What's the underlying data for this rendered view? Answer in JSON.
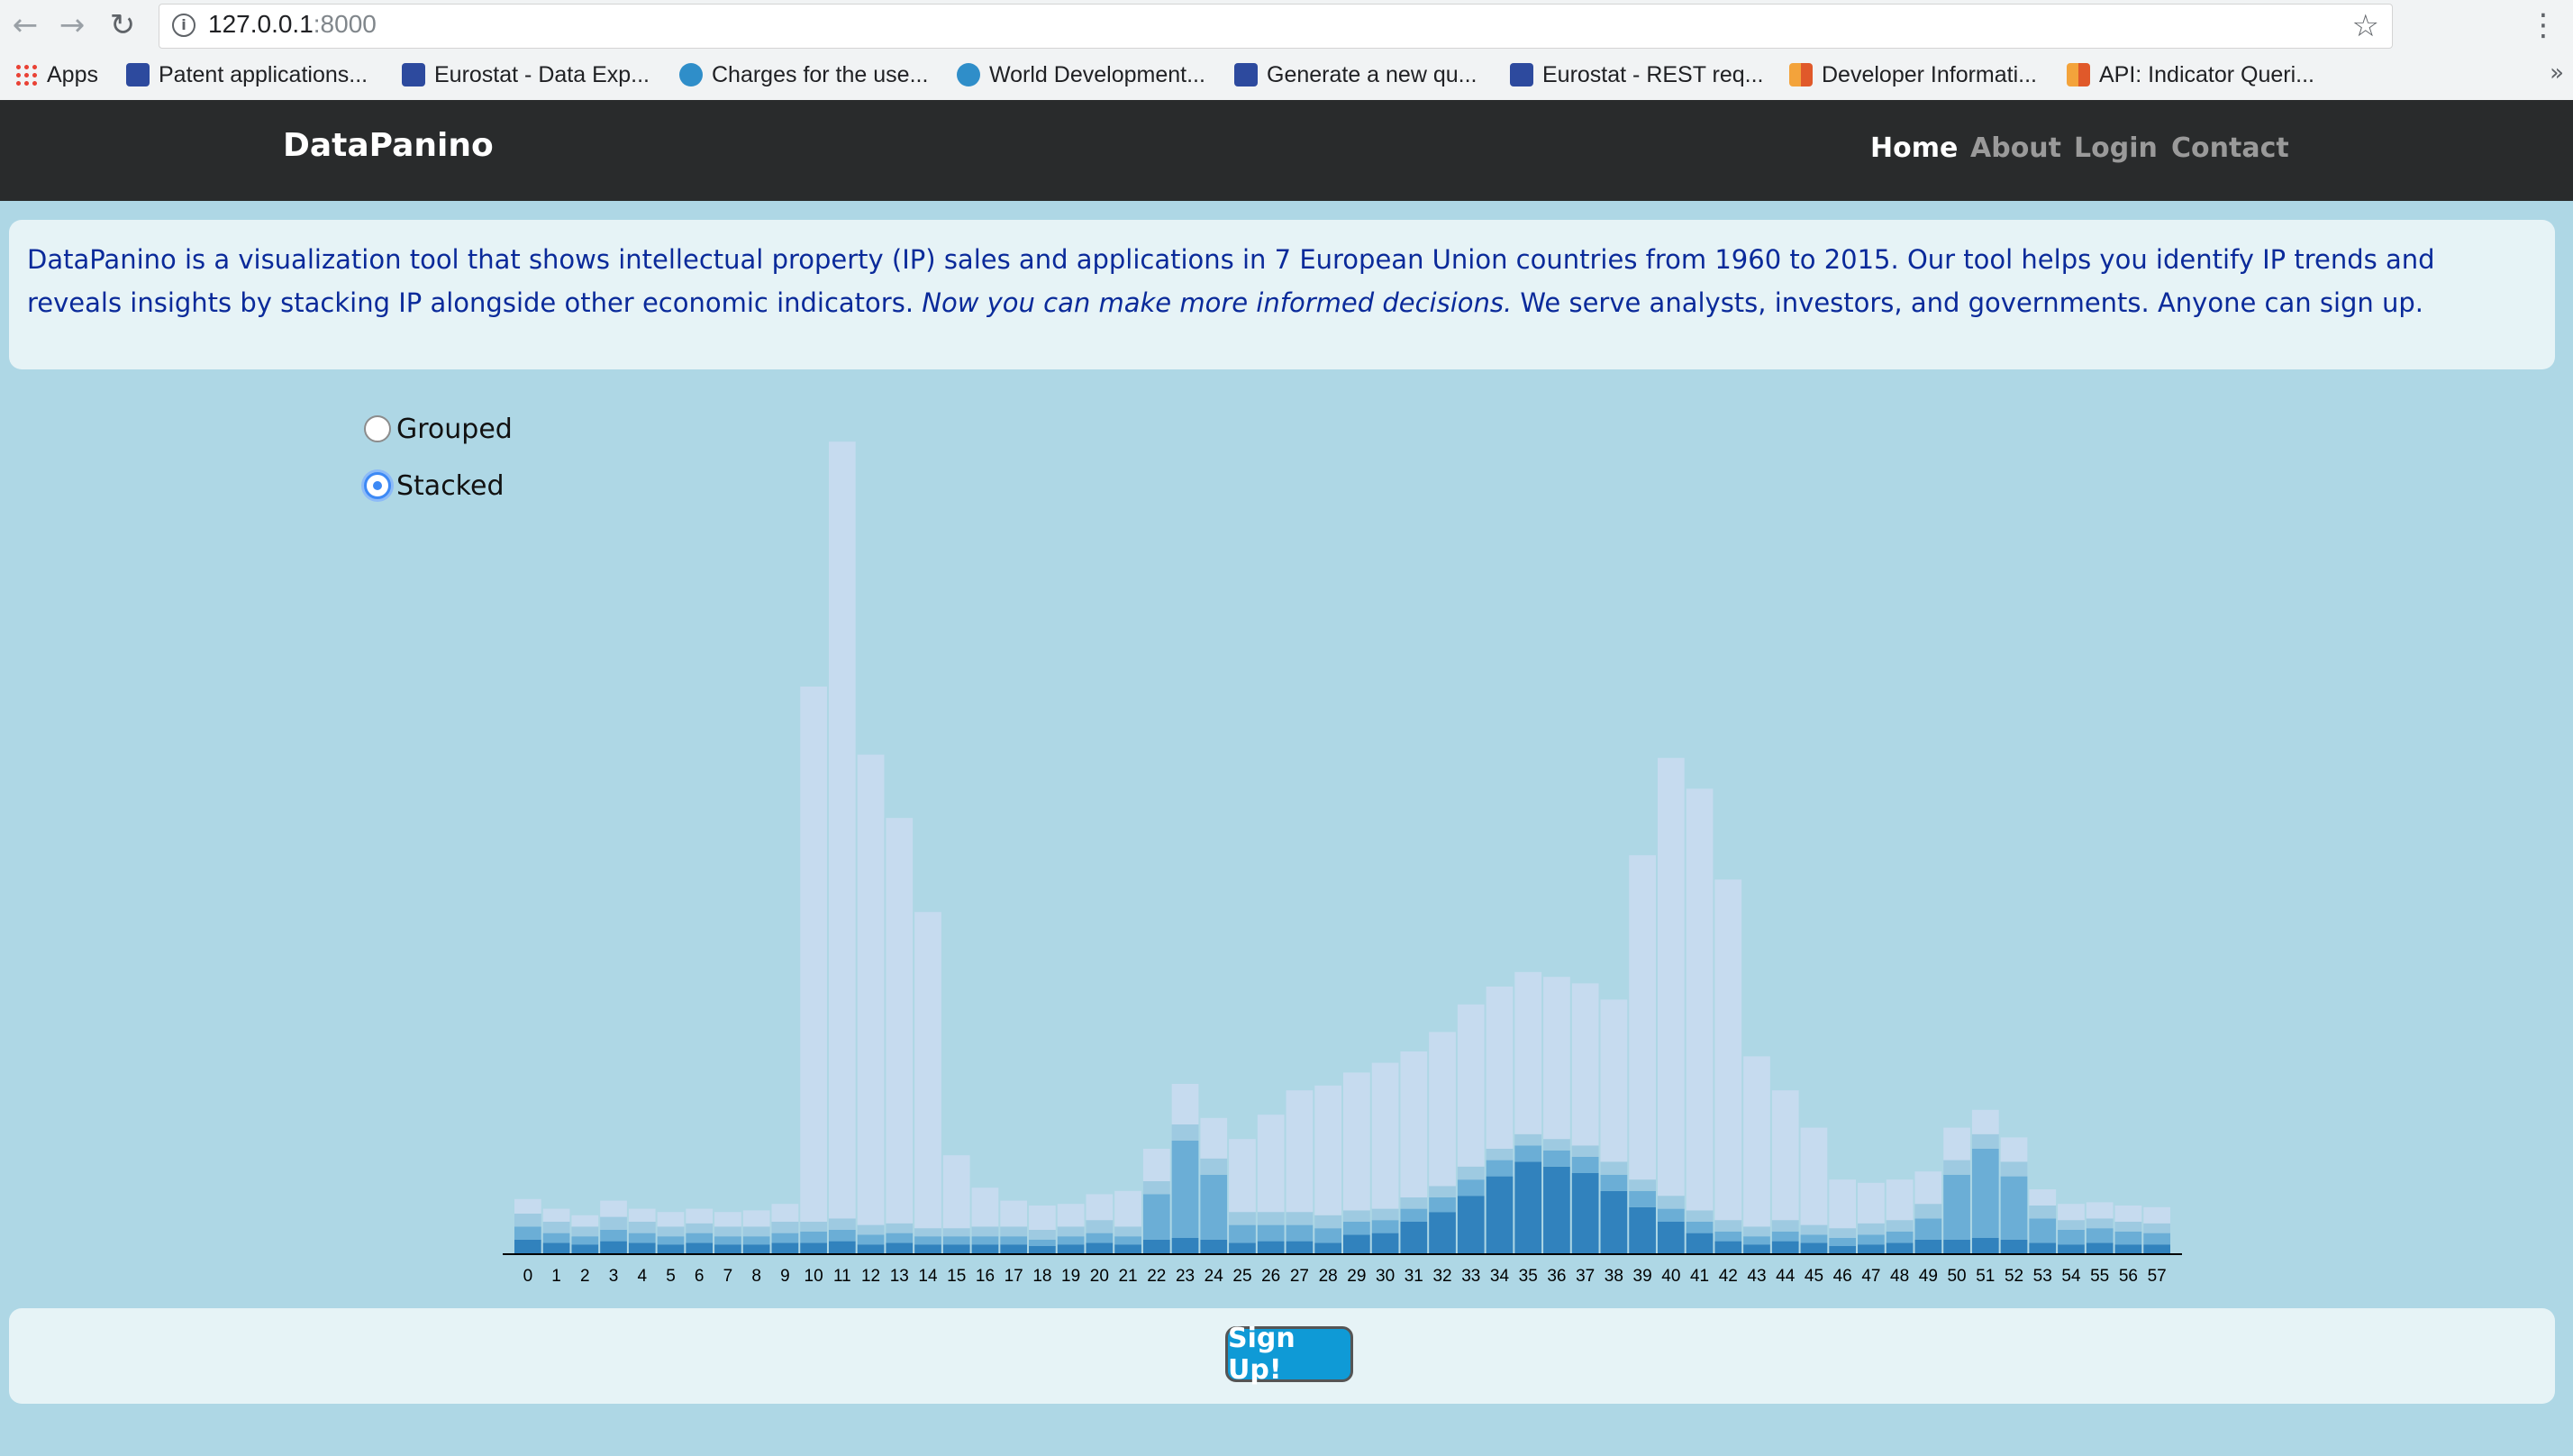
{
  "browser": {
    "url_host": "127.0.0.1",
    "url_port": ":8000",
    "bookmarks": [
      {
        "label": "Apps",
        "icon": "apps-icon"
      },
      {
        "label": "Patent applications...",
        "icon": "eurostat-icon"
      },
      {
        "label": "Eurostat - Data Exp...",
        "icon": "eurostat-icon"
      },
      {
        "label": "Charges for the use...",
        "icon": "worldbank-icon"
      },
      {
        "label": "World Development...",
        "icon": "worldbank-icon"
      },
      {
        "label": "Generate a new qu...",
        "icon": "eurostat-icon"
      },
      {
        "label": "Eurostat - REST req...",
        "icon": "eurostat-icon"
      },
      {
        "label": "Developer Informati...",
        "icon": "oecd-icon"
      },
      {
        "label": "API: Indicator Queri...",
        "icon": "oecd-icon"
      }
    ],
    "more": "»"
  },
  "navbar": {
    "brand": "DataPanino",
    "links": [
      {
        "label": "Home",
        "active": true
      },
      {
        "label": "About",
        "active": false
      },
      {
        "label": "Login",
        "active": false
      },
      {
        "label": "Contact",
        "active": false
      }
    ]
  },
  "intro": {
    "text_before": "DataPanino is a visualization tool that shows intellectual property (IP) sales and applications in 7 European Union countries from 1960 to 2015. Our tool helps you identify IP trends and reveals insights by stacking IP alongside other economic indicators. ",
    "text_em": "Now you can make more informed decisions.",
    "text_after": " We serve analysts, investors, and governments. Anyone can sign up."
  },
  "controls": {
    "options": [
      {
        "label": "Grouped",
        "checked": false
      },
      {
        "label": "Stacked",
        "checked": true
      }
    ]
  },
  "chart_data": {
    "type": "bar",
    "stacked": true,
    "categories": [
      "0",
      "1",
      "2",
      "3",
      "4",
      "5",
      "6",
      "7",
      "8",
      "9",
      "10",
      "11",
      "12",
      "13",
      "14",
      "15",
      "16",
      "17",
      "18",
      "19",
      "20",
      "21",
      "22",
      "23",
      "24",
      "25",
      "26",
      "27",
      "28",
      "29",
      "30",
      "31",
      "32",
      "33",
      "34",
      "35",
      "36",
      "37",
      "38",
      "39",
      "40",
      "41",
      "42",
      "43",
      "44",
      "45",
      "46",
      "47",
      "48",
      "49",
      "50",
      "51",
      "52",
      "53",
      "54",
      "55",
      "56",
      "57"
    ],
    "ylim": [
      0,
      1000
    ],
    "colors": [
      "#3182bd",
      "#6baed6",
      "#9ecae1",
      "#c6dbef"
    ],
    "series": [
      {
        "values": [
          18,
          14,
          12,
          16,
          14,
          12,
          14,
          12,
          12,
          14,
          14,
          16,
          12,
          14,
          12,
          12,
          12,
          12,
          10,
          12,
          14,
          12,
          18,
          20,
          18,
          14,
          16,
          16,
          14,
          24,
          26,
          40,
          52,
          72,
          96,
          114,
          108,
          100,
          78,
          58,
          40,
          26,
          16,
          12,
          16,
          14,
          10,
          12,
          14,
          18,
          18,
          20,
          18,
          14,
          12,
          14,
          12,
          12
        ]
      },
      {
        "values": [
          16,
          12,
          10,
          14,
          12,
          10,
          12,
          10,
          10,
          12,
          14,
          14,
          12,
          12,
          10,
          10,
          10,
          10,
          8,
          10,
          12,
          10,
          56,
          120,
          80,
          22,
          20,
          20,
          18,
          16,
          16,
          16,
          18,
          20,
          20,
          20,
          20,
          20,
          20,
          20,
          16,
          14,
          12,
          10,
          12,
          10,
          10,
          12,
          14,
          26,
          80,
          110,
          78,
          30,
          18,
          18,
          16,
          14
        ]
      },
      {
        "values": [
          16,
          14,
          12,
          16,
          14,
          12,
          12,
          12,
          12,
          14,
          12,
          14,
          12,
          12,
          10,
          10,
          12,
          12,
          12,
          12,
          16,
          12,
          16,
          20,
          20,
          16,
          16,
          16,
          16,
          14,
          14,
          14,
          14,
          16,
          14,
          14,
          14,
          14,
          16,
          14,
          16,
          14,
          14,
          12,
          14,
          12,
          12,
          14,
          14,
          18,
          18,
          18,
          18,
          16,
          12,
          12,
          12,
          12
        ]
      },
      {
        "values": [
          18,
          16,
          14,
          20,
          16,
          18,
          18,
          18,
          20,
          22,
          660,
          958,
          580,
          500,
          390,
          90,
          48,
          32,
          30,
          28,
          32,
          44,
          40,
          50,
          50,
          90,
          120,
          150,
          160,
          170,
          180,
          180,
          190,
          200,
          200,
          200,
          200,
          200,
          200,
          400,
          540,
          520,
          420,
          210,
          160,
          120,
          60,
          50,
          50,
          40,
          40,
          30,
          30,
          20,
          20,
          20,
          20,
          20
        ]
      }
    ]
  },
  "signup": {
    "label": "Sign Up!"
  }
}
